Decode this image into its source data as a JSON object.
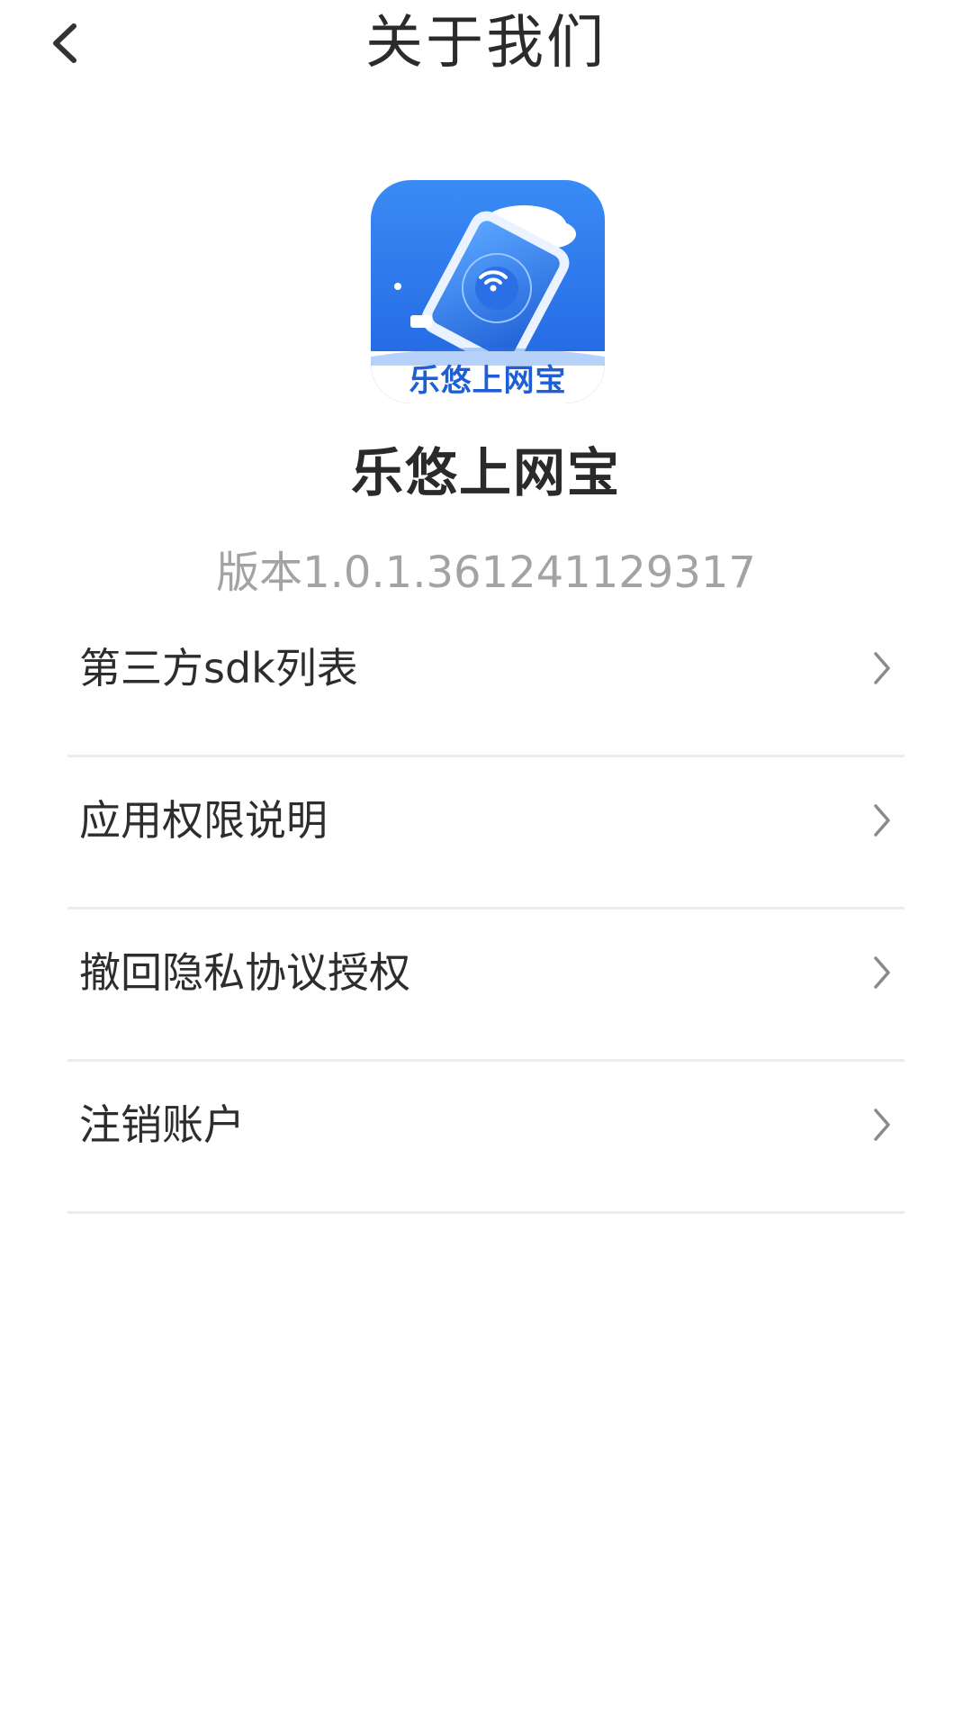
{
  "nav": {
    "title": "关于我们",
    "back_icon": "chevron-left-icon"
  },
  "app": {
    "logo_text": "乐悠上网宝",
    "name": "乐悠上网宝",
    "version": "版本1.0.1.361241129317"
  },
  "menu": {
    "items": [
      {
        "label": "第三方sdk列表"
      },
      {
        "label": "应用权限说明"
      },
      {
        "label": "撤回隐私协议授权"
      },
      {
        "label": "注销账户"
      }
    ]
  },
  "colors": {
    "text_primary": "#2d2d2d",
    "text_secondary": "#a3a3a3",
    "divider": "#ececec",
    "logo_blue": "#2f7cf2"
  }
}
